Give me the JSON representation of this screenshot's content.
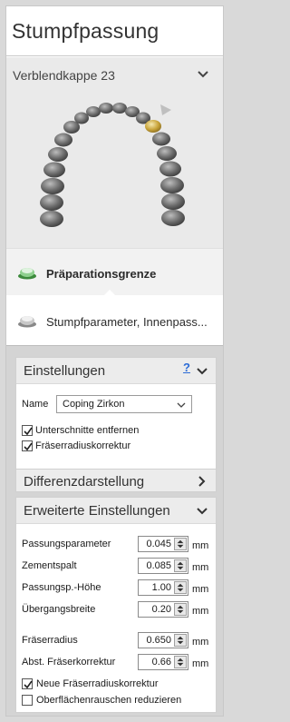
{
  "title": "Stumpfpassung",
  "jaw": {
    "label": "Verblendkappe 23"
  },
  "steps": [
    {
      "label": "Präparationsgrenze"
    },
    {
      "label": "Stumpfparameter, Innenpass..."
    }
  ],
  "einstellungen": {
    "title": "Einstellungen",
    "help": "?",
    "name_label": "Name",
    "name_value": "Coping Zirkon",
    "checkboxes": [
      {
        "label": "Unterschnitte entfernen",
        "checked": true
      },
      {
        "label": "Fräserradiuskorrektur",
        "checked": true
      }
    ]
  },
  "differenz": {
    "title": "Differenzdarstellung"
  },
  "erweitert": {
    "title": "Erweiterte Einstellungen",
    "params": [
      {
        "label": "Passungsparameter",
        "value": "0.045",
        "unit": "mm"
      },
      {
        "label": "Zementspalt",
        "value": "0.085",
        "unit": "mm"
      },
      {
        "label": "Passungsp.-Höhe",
        "value": "1.00",
        "unit": "mm"
      },
      {
        "label": "Übergangsbreite",
        "value": "0.20",
        "unit": "mm"
      },
      {
        "label": "Fräserradius",
        "value": "0.650",
        "unit": "mm"
      },
      {
        "label": "Abst. Fräserkorrektur",
        "value": "0.66",
        "unit": "mm"
      }
    ],
    "checkboxes": [
      {
        "label": "Neue Fräserradiuskorrektur",
        "checked": true
      },
      {
        "label": "Oberflächenrauschen reduzieren",
        "checked": false
      }
    ]
  },
  "colors": {
    "accent": "#2a6bd6",
    "highlight_tooth": "#d9b84a",
    "step_icon": "#4caf50"
  }
}
